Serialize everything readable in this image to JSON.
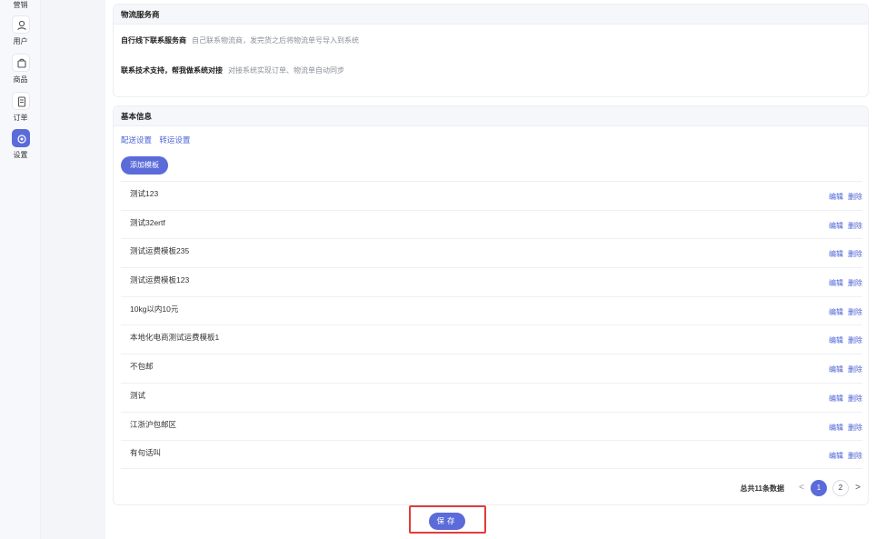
{
  "sidebar": {
    "items": [
      {
        "label": "营销",
        "icon": "marketing-icon",
        "active": false
      },
      {
        "label": "用户",
        "icon": "user-icon",
        "active": false
      },
      {
        "label": "商品",
        "icon": "bag-icon",
        "active": false
      },
      {
        "label": "订单",
        "icon": "document-icon",
        "active": false
      },
      {
        "label": "设置",
        "icon": "settings-icon",
        "active": true
      }
    ]
  },
  "service": {
    "header": "物流服务商",
    "rows": [
      {
        "title": "自行线下联系服务商",
        "desc": "自己联系物流商，发完货之后将物流单号导入到系统"
      },
      {
        "title": "联系技术支持，帮我做系统对接",
        "desc": "对接系统实现订单、物流单自动同步"
      }
    ]
  },
  "basic": {
    "header": "基本信息",
    "tabs": [
      "配送设置",
      "转运设置"
    ],
    "add_button": "添加模板",
    "edit_label": "编辑",
    "delete_label": "删除",
    "templates": [
      "测试123",
      "测试32ertf",
      "测试运费模板235",
      "测试运费模板123",
      "10kg以内10元",
      "本地化电商测试运费模板1",
      "不包邮",
      "测试",
      "江浙沪包邮区",
      "有句话叫"
    ],
    "pagination": {
      "total_text": "总共11条数据",
      "pages": [
        "1",
        "2"
      ],
      "current_page": "1",
      "prev": "<",
      "next": ">"
    }
  },
  "save_button": "保存",
  "colors": {
    "accent": "#5b6bd9",
    "link": "#4a62d6",
    "highlight": "#e23b3b"
  }
}
